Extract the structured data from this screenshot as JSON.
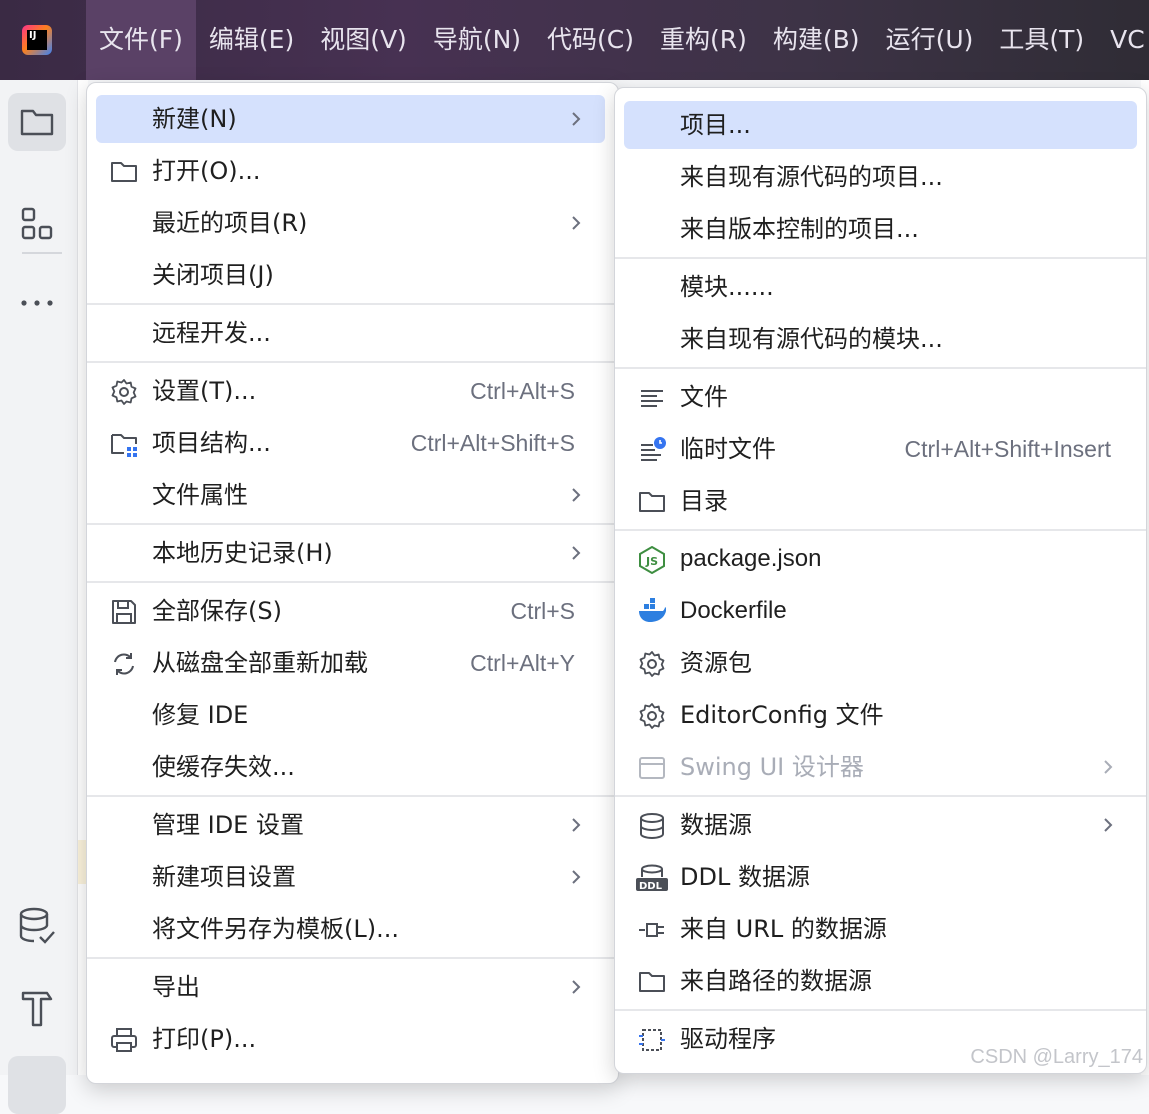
{
  "menubar": {
    "logo_text": "IJ",
    "items": [
      "文件(F)",
      "编辑(E)",
      "视图(V)",
      "导航(N)",
      "代码(C)",
      "重构(R)",
      "构建(B)",
      "运行(U)",
      "工具(T)",
      "VC"
    ]
  },
  "toolstrip": {
    "icons": [
      "folder-icon",
      "structure-icon",
      "more-icon",
      "database-icon",
      "build-hammer-icon"
    ]
  },
  "file_menu": {
    "new": "新建(N)",
    "open": "打开(O)...",
    "recent": "最近的项目(R)",
    "close": "关闭项目(J)",
    "remote": "远程开发...",
    "settings": "设置(T)...",
    "settings_sc": "Ctrl+Alt+S",
    "structure": "项目结构...",
    "structure_sc": "Ctrl+Alt+Shift+S",
    "properties": "文件属性",
    "history": "本地历史记录(H)",
    "save_all": "全部保存(S)",
    "save_all_sc": "Ctrl+S",
    "reload": "从磁盘全部重新加载",
    "reload_sc": "Ctrl+Alt+Y",
    "repair": "修复 IDE",
    "invalidate": "使缓存失效...",
    "manage_ide": "管理 IDE 设置",
    "new_proj_settings": "新建项目设置",
    "save_template": "将文件另存为模板(L)...",
    "export": "导出",
    "print": "打印(P)..."
  },
  "new_menu": {
    "project": "项目...",
    "from_sources": "来自现有源代码的项目...",
    "from_vcs": "来自版本控制的项目...",
    "module": "模块......",
    "module_sources": "来自现有源代码的模块...",
    "file": "文件",
    "scratch": "临时文件",
    "scratch_sc": "Ctrl+Alt+Shift+Insert",
    "directory": "目录",
    "package_json": "package.json",
    "dockerfile": "Dockerfile",
    "resource_bundle": "资源包",
    "editorconfig": "EditorConfig 文件",
    "swing": "Swing UI 设计器",
    "datasource": "数据源",
    "ddl_datasource": "DDL 数据源",
    "url_datasource": "来自 URL 的数据源",
    "path_datasource": "来自路径的数据源",
    "driver": "驱动程序",
    "ddl_badge": "DDL"
  },
  "colors": {
    "menubar": "#473152",
    "highlight": "#d5e1fd",
    "node_green": "#3e8e41",
    "docker_blue": "#2d7fe0"
  },
  "watermark": "CSDN @Larry_174"
}
